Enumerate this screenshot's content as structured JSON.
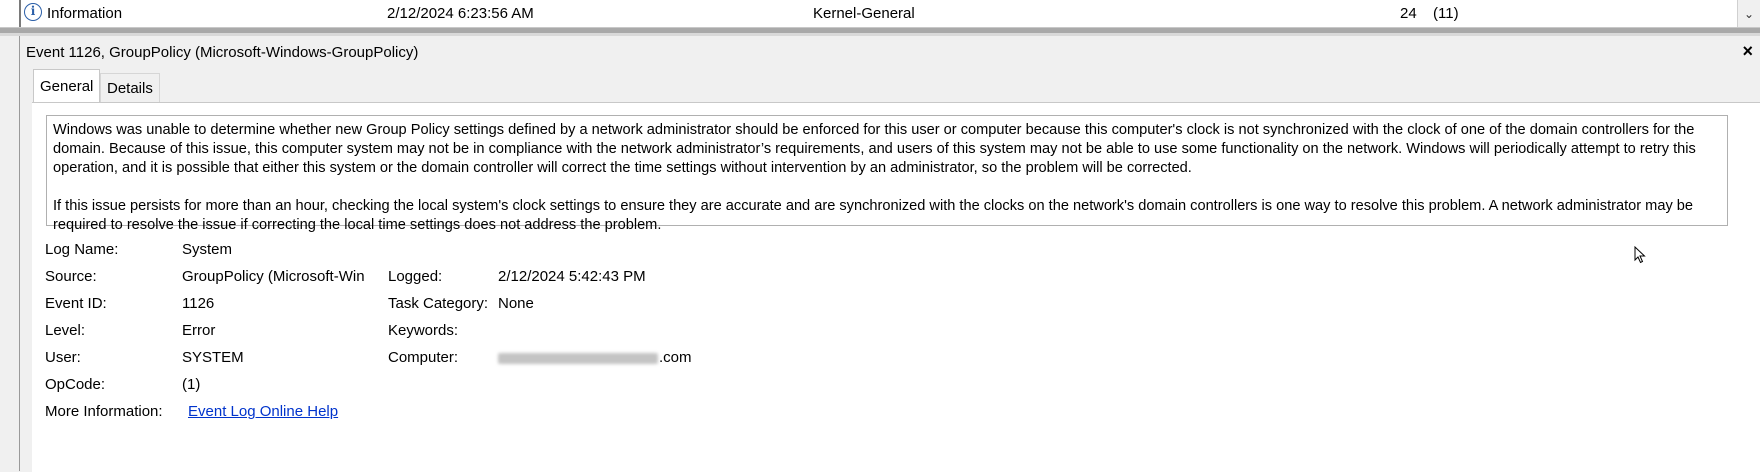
{
  "event_list_row": {
    "level": "Information",
    "date_time": "2/12/2024 6:23:56 AM",
    "source": "Kernel-General",
    "event_id": "24",
    "task_category": "(11)"
  },
  "pane": {
    "title": "Event 1126, GroupPolicy (Microsoft-Windows-GroupPolicy)",
    "close_label": "×",
    "tabs": [
      {
        "label": "General",
        "selected": true
      },
      {
        "label": "Details",
        "selected": false
      }
    ],
    "description": [
      "Windows was unable to determine whether new Group Policy settings defined by a network administrator should be enforced for this user or computer because this computer's clock is not synchronized with the clock of one of the domain controllers for the domain. Because of this issue, this computer system may not be in compliance with the network administrator’s requirements, and users of this system may not be able to use some functionality on the network. Windows will periodically attempt to retry this operation, and it is possible that either this system or the domain controller will correct the time settings without intervention by an administrator, so the problem will be corrected.",
      "If this issue persists for more than an hour, checking the local system's clock settings to ensure they are accurate and are synchronized with the clocks on the network's domain controllers is one way to resolve this problem. A network administrator may be required to resolve the issue if correcting the local time settings does not address the problem."
    ],
    "fields": {
      "log_name": {
        "label": "Log Name:",
        "value": "System"
      },
      "source": {
        "label": "Source:",
        "value": "GroupPolicy (Microsoft-Win"
      },
      "logged": {
        "label": "Logged:",
        "value": "2/12/2024 5:42:43 PM"
      },
      "event_id": {
        "label": "Event ID:",
        "value": "1126"
      },
      "task_category": {
        "label": "Task Category:",
        "value": "None"
      },
      "level": {
        "label": "Level:",
        "value": "Error"
      },
      "keywords": {
        "label": "Keywords:",
        "value": ""
      },
      "user": {
        "label": "User:",
        "value": "SYSTEM"
      },
      "computer": {
        "label": "Computer:",
        "value": ".com"
      },
      "opcode": {
        "label": "OpCode:",
        "value": "(1)"
      },
      "more_info": {
        "label": "More Information:",
        "value": "Event Log Online Help"
      }
    }
  },
  "colors": {
    "link": "#0033cc",
    "info_icon": "#2b5fa8"
  }
}
